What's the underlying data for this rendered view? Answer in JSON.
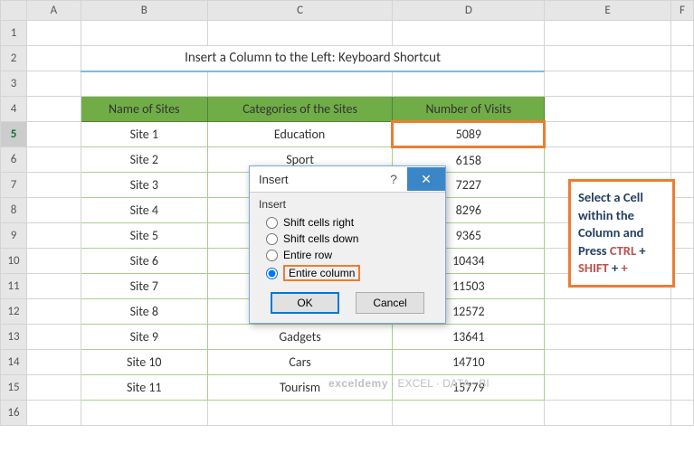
{
  "cols": {
    "A": "A",
    "B": "B",
    "C": "C",
    "D": "D",
    "E": "E",
    "F": "F"
  },
  "rows": [
    "1",
    "2",
    "3",
    "4",
    "5",
    "6",
    "7",
    "8",
    "9",
    "10",
    "11",
    "12",
    "13",
    "14",
    "15",
    "16"
  ],
  "title": "Insert a Column to the Left: Keyboard Shortcut",
  "headers": {
    "b": "Name of Sites",
    "c": "Categories of the Sites",
    "d": "Number of Visits"
  },
  "sites": [
    {
      "name": "Site 1",
      "cat": "Education",
      "visits": "5089"
    },
    {
      "name": "Site 2",
      "cat": "Sport",
      "visits": "6158"
    },
    {
      "name": "Site 3",
      "cat": "",
      "visits": "7227"
    },
    {
      "name": "Site 4",
      "cat": "",
      "visits": "8296"
    },
    {
      "name": "Site 5",
      "cat": "",
      "visits": "9365"
    },
    {
      "name": "Site 6",
      "cat": "",
      "visits": "10434"
    },
    {
      "name": "Site 7",
      "cat": "",
      "visits": "11503"
    },
    {
      "name": "Site 8",
      "cat": "",
      "visits": "12572"
    },
    {
      "name": "Site 9",
      "cat": "Gadgets",
      "visits": "13641"
    },
    {
      "name": "Site 10",
      "cat": "Cars",
      "visits": "14710"
    },
    {
      "name": "Site 11",
      "cat": "Tourism",
      "visits": "15779"
    }
  ],
  "dialog": {
    "title": "Insert",
    "group": "Insert",
    "opts": {
      "right": "Shift cells right",
      "down": "Shift cells down",
      "row": "Entire row",
      "col": "Entire column"
    },
    "ok": "OK",
    "cancel": "Cancel"
  },
  "callout": {
    "l1": "Select a Cell",
    "l2": "within the",
    "l3": "Column and",
    "l4a": "Press ",
    "l4b": "CTRL",
    "l4c": " +",
    "l5a": "SHIFT",
    "l5b": " + ",
    "l5c": "+"
  },
  "watermark": {
    "brand": "exceldemy",
    "tag": " · EXCEL · DATA · BI"
  },
  "chart_data": {
    "type": "table",
    "title": "Insert a Column to the Left: Keyboard Shortcut",
    "columns": [
      "Name of Sites",
      "Categories of the Sites",
      "Number of Visits"
    ],
    "rows": [
      [
        "Site 1",
        "Education",
        5089
      ],
      [
        "Site 2",
        "Sport",
        6158
      ],
      [
        "Site 3",
        null,
        7227
      ],
      [
        "Site 4",
        null,
        8296
      ],
      [
        "Site 5",
        null,
        9365
      ],
      [
        "Site 6",
        null,
        10434
      ],
      [
        "Site 7",
        null,
        11503
      ],
      [
        "Site 8",
        null,
        12572
      ],
      [
        "Site 9",
        "Gadgets",
        13641
      ],
      [
        "Site 10",
        "Cars",
        14710
      ],
      [
        "Site 11",
        "Tourism",
        15779
      ]
    ]
  }
}
